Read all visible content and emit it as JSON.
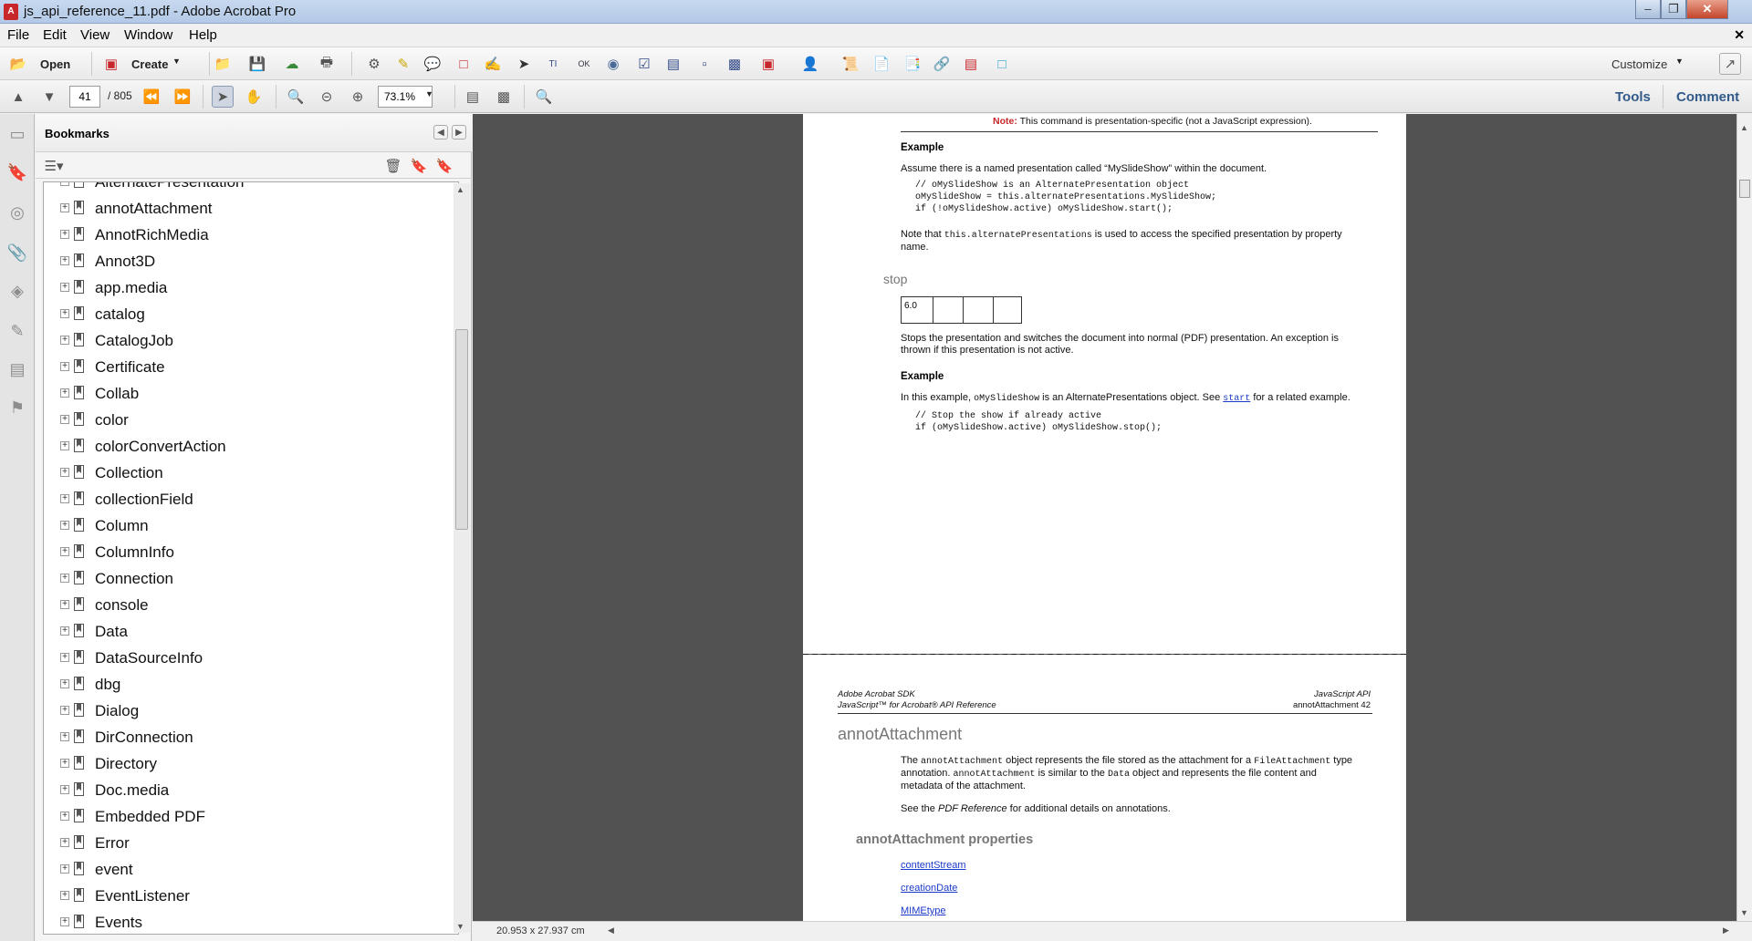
{
  "window": {
    "title": "js_api_reference_11.pdf - Adobe Acrobat Pro",
    "icon": "acrobat-icon"
  },
  "menu": [
    "File",
    "Edit",
    "View",
    "Window",
    "Help"
  ],
  "toolbar": {
    "open": "Open",
    "create": "Create",
    "customize": "Customize"
  },
  "nav": {
    "page": "41",
    "total": "/ 805",
    "zoom": "73.1%",
    "tools": "Tools",
    "comment": "Comment"
  },
  "panel": {
    "title": "Bookmarks"
  },
  "bookmarks": [
    "AlternatePresentation",
    "annotAttachment",
    "AnnotRichMedia",
    "Annot3D",
    "app.media",
    "catalog",
    "CatalogJob",
    "Certificate",
    "Collab",
    "color",
    "colorConvertAction",
    "Collection",
    "collectionField",
    "Column",
    "ColumnInfo",
    "Connection",
    "console",
    "Data",
    "DataSourceInfo",
    "dbg",
    "Dialog",
    "DirConnection",
    "Directory",
    "Doc.media",
    "Embedded PDF",
    "Error",
    "event",
    "EventListener",
    "Events"
  ],
  "page1": {
    "note_label": "Note:",
    "note_text": "This command is presentation-specific (not a JavaScript expression).",
    "example1": "Example",
    "ex1_text": "Assume there is a named presentation called “MySlideShow” within the document.",
    "code1": [
      "// oMySlideShow is an AlternatePresentation object",
      "oMySlideShow = this.alternatePresentations.MySlideShow;",
      "if (!oMySlideShow.active) oMySlideShow.start();"
    ],
    "note2_a": "Note that ",
    "note2_code": "this.alternatePresentations",
    "note2_b": " is used to access the specified presentation by property",
    "note2_c": "name.",
    "stop_heading": "stop",
    "version": "6.0",
    "stop_desc1": "Stops the presentation and switches the document into normal (PDF) presentation. An exception is",
    "stop_desc2": "thrown if this presentation is not active.",
    "example2": "Example",
    "ex2_a": "In this example, ",
    "ex2_code": "oMySlideShow",
    "ex2_b": " is an AlternatePresentations object. See ",
    "ex2_link": "start",
    "ex2_c": " for a related example.",
    "code2": [
      "// Stop the show if already active",
      "if (oMySlideShow.active) oMySlideShow.stop();"
    ]
  },
  "page2": {
    "hdr_left1": "Adobe Acrobat SDK",
    "hdr_left2": "JavaScript™ for Acrobat® API Reference",
    "hdr_right1": "JavaScript API",
    "hdr_right2": "annotAttachment   42",
    "heading": "annotAttachment",
    "p1_a": "The ",
    "p1_code1": "annotAttachment",
    "p1_b": " object represents the file stored as the attachment for a ",
    "p1_code2": "FileAttachment",
    "p1_c": " type",
    "p2_a": "annotation. ",
    "p2_code": "annotAttachment",
    "p2_b": " is similar to the ",
    "p2_code2": "Data",
    "p2_c": " object and represents the file content and",
    "p3": "metadata of the attachment.",
    "see_a": "See the ",
    "see_em": "PDF Reference",
    "see_b": " for additional details on annotations.",
    "props_heading": "annotAttachment properties",
    "links": [
      "contentStream",
      "creationDate",
      "MIMEtype"
    ]
  },
  "status": {
    "size": "20.953 x 27.937 cm"
  }
}
